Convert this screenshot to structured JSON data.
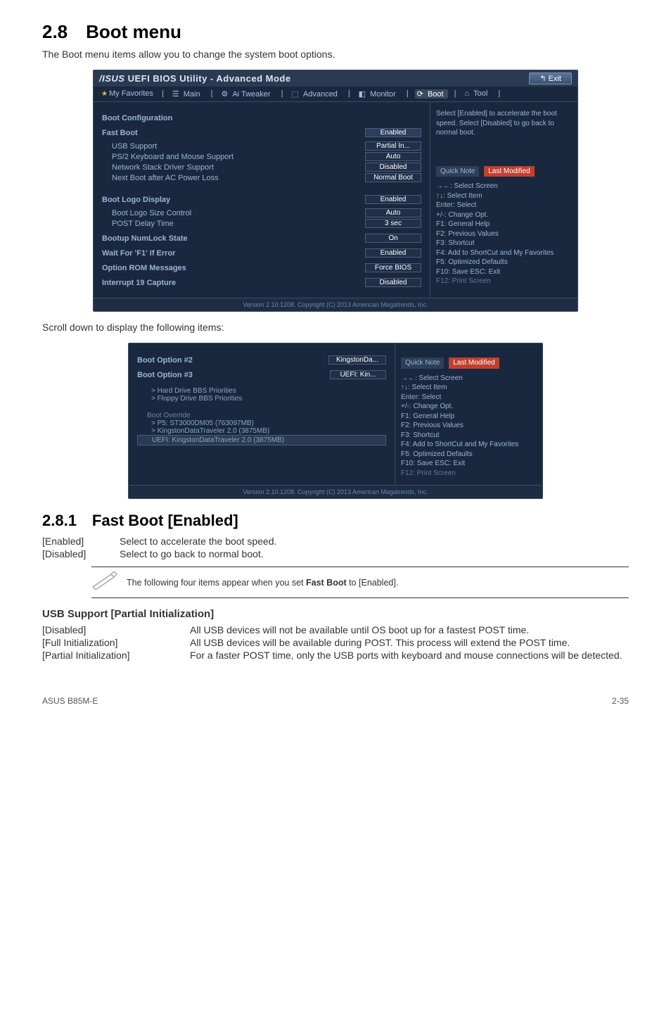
{
  "section": {
    "number_title": "2.8 Boot menu",
    "intro": "The Boot menu items allow you to change the system boot options."
  },
  "bios1": {
    "window_title": "UEFI BIOS Utility - Advanced Mode",
    "brand": "/ISUS",
    "exit": "Exit",
    "tabs": [
      "My Favorites",
      "Main",
      "Ai Tweaker",
      "Advanced",
      "Monitor",
      "Boot",
      "Tool"
    ],
    "tab_icons": [
      "★",
      "≡",
      "⚙",
      "⚙",
      "◧",
      "⟳",
      "⌂"
    ],
    "hint": "Select [Enabled] to accelerate the boot speed. Select [Disabled] to go back to normal boot.",
    "groups": [
      {
        "header": "Boot Configuration"
      },
      {
        "header": "Fast Boot",
        "value": "Enabled"
      },
      {
        "label": "USB Support",
        "value": "Partial In..."
      },
      {
        "label": "PS/2 Keyboard and Mouse Support",
        "value": "Auto"
      },
      {
        "label": "Network Stack Driver Support",
        "value": "Disabled"
      },
      {
        "label": "Next Boot after AC Power Loss",
        "value": "Normal Boot"
      },
      {
        "spacer": true
      },
      {
        "header": "Boot Logo Display",
        "value": "Enabled"
      },
      {
        "label": "Boot Logo Size Control",
        "value": "Auto"
      },
      {
        "label": "POST Delay Time",
        "value": "3 sec"
      },
      {
        "header2": "Bootup NumLock State",
        "value": "On"
      },
      {
        "header2": "Wait For 'F1' If Error",
        "value": "Enabled"
      },
      {
        "header2": "Option ROM Messages",
        "value": "Force BIOS"
      },
      {
        "header2": "Interrupt 19 Capture",
        "value": "Disabled"
      }
    ],
    "legend": {
      "quick": "Quick Note",
      "last": "Last Modified",
      "lines": [
        "→←: Select Screen",
        "↑↓: Select Item",
        "Enter: Select",
        "+/-: Change Opt.",
        "F1: General Help",
        "F2: Previous Values",
        "F3: Shortcut",
        "F4: Add to ShortCut and My Favorites",
        "F5: Optimized Defaults",
        "F10: Save  ESC: Exit",
        "F12: Print Screen"
      ]
    },
    "footer": "Version 2.10.1208. Copyright (C) 2013 American Megatrends, Inc."
  },
  "scroll_text": "Scroll down to display the following items:",
  "bios2": {
    "rows": [
      {
        "header": "Boot Option #2",
        "value": "KingstonDa..."
      },
      {
        "header": "Boot Option #3",
        "value": "UEFI: Kin..."
      }
    ],
    "sub": [
      "> Hard Drive BBS Priorities",
      "> Floppy Drive BBS Priorities"
    ],
    "override_header": "Boot Override",
    "override": [
      "> P5: ST3000DM05   (763097MB)",
      "> KingstonDataTraveler 2.0  (3875MB)"
    ],
    "override_sel": "UEFI:  KingstonDataTraveler 2.0 (3875MB)",
    "legend": {
      "quick": "Quick Note",
      "last": "Last Modified",
      "lines": [
        "→←: Select Screen",
        "↑↓: Select Item",
        "Enter: Select",
        "+/-: Change Opt.",
        "F1: General Help",
        "F2: Previous Values",
        "F3: Shortcut",
        "F4: Add to ShortCut and My Favorites",
        "F5: Optimized Defaults",
        "F10: Save  ESC: Exit",
        "F12: Print Screen"
      ]
    },
    "footer": "Version 2.10.1208. Copyright (C) 2013 American Megatrends, Inc."
  },
  "subsection": {
    "title": "2.8.1 Fast Boot [Enabled]",
    "defs": [
      {
        "term": "[Enabled]",
        "desc": "Select to accelerate the boot speed."
      },
      {
        "term": "[Disabled]",
        "desc": "Select to go back to normal boot."
      }
    ],
    "note": "The following four items appear when you set Fast Boot to [Enabled].",
    "note_html_prefix": "The following four items appear when you set ",
    "note_bold": "Fast Boot",
    "note_html_suffix": " to [Enabled].",
    "usb_heading": "USB Support [Partial Initialization]",
    "usb_defs": [
      {
        "term": "[Disabled]",
        "desc": "All USB devices will not be available until OS boot up for a fastest POST time."
      },
      {
        "term": "[Full Initialization]",
        "desc": "All USB devices will be available during POST. This process will extend the POST time."
      },
      {
        "term": "[Partial Initialization]",
        "desc": "For a faster POST time, only the USB ports with keyboard and mouse connections will be detected."
      }
    ]
  },
  "footer": {
    "left": "ASUS B85M-E",
    "right": "2-35"
  }
}
